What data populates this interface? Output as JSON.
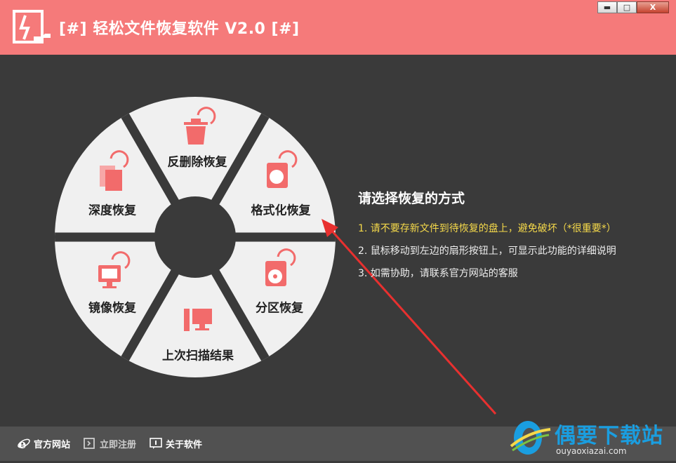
{
  "app": {
    "title": "[#] 轻松文件恢复软件 V2.0 [#]"
  },
  "window_controls": {
    "minimize": "▬",
    "maximize": "□",
    "close": "X"
  },
  "wheel": {
    "segments": [
      {
        "label": "反删除恢复",
        "icon": "trash-restore-icon"
      },
      {
        "label": "格式化恢复",
        "icon": "disk-format-icon"
      },
      {
        "label": "分区恢复",
        "icon": "partition-disc-icon"
      },
      {
        "label": "上次扫描结果",
        "icon": "computer-scan-icon"
      },
      {
        "label": "镜像恢复",
        "icon": "monitor-restore-icon"
      },
      {
        "label": "深度恢复",
        "icon": "deep-file-icon"
      }
    ]
  },
  "info": {
    "title": "请选择恢复的方式",
    "tips": [
      "1. 请不要存新文件到待恢复的盘上，避免破坏（*很重要*）",
      "2. 鼠标移动到左边的扇形按钮上，可显示此功能的详细说明",
      "3. 如需协助，请联系官方网站的客服"
    ]
  },
  "bottom": {
    "links": [
      {
        "label": "官方网站",
        "icon": "ie-browser-icon"
      },
      {
        "label": "立即注册",
        "icon": "register-icon"
      },
      {
        "label": "关于软件",
        "icon": "about-icon"
      }
    ]
  },
  "watermark": {
    "text": "偶要下载站",
    "url": "ouyaoxiazai.com"
  },
  "colors": {
    "accent": "#f57a7a",
    "background": "#3a3a3a",
    "segment": "#f0f0f0",
    "icon": "#f26b6b",
    "highlight": "#f5d94a",
    "arrow": "#e8302f"
  }
}
